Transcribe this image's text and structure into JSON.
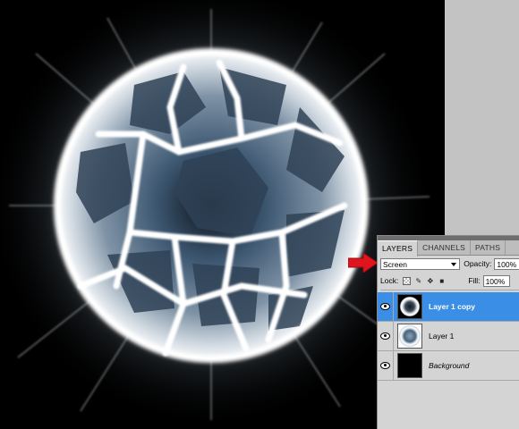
{
  "layers_panel": {
    "tabs": [
      {
        "label": "LAYERS",
        "active": true
      },
      {
        "label": "CHANNELS",
        "active": false
      },
      {
        "label": "PATHS",
        "active": false
      }
    ],
    "blend_mode": "Screen",
    "opacity_label": "Opacity:",
    "opacity_value": "100%",
    "lock_label": "Lock:",
    "fill_label": "Fill:",
    "fill_value": "100%",
    "layers": [
      {
        "name": "Layer 1 copy",
        "selected": true,
        "visible": true,
        "thumbnail": "orb-dark"
      },
      {
        "name": "Layer 1",
        "selected": false,
        "visible": true,
        "thumbnail": "orb"
      },
      {
        "name": "Background",
        "selected": false,
        "visible": true,
        "thumbnail": "black"
      }
    ]
  },
  "colors": {
    "selection_blue": "#3a8ee6",
    "annotation_arrow": "#e0141c",
    "canvas_background": "#000000",
    "workspace_gray": "#c3c3c3"
  },
  "icons": [
    "eye-icon",
    "lock-transparency-icon",
    "lock-brush-icon",
    "lock-move-icon",
    "lock-all-icon",
    "dropdown-arrow-icon"
  ]
}
